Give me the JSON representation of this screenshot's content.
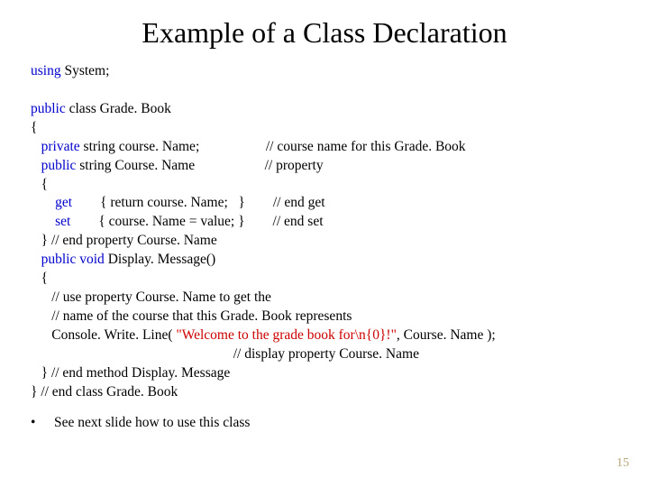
{
  "title": "Example of a Class Declaration",
  "code": {
    "l01a": "using",
    "l01b": " System;",
    "blank1": "",
    "l02a": "public",
    "l02b": " class Grade. Book",
    "l03": "{",
    "l04a": "   private",
    "l04b": " string course. Name;                   // course name for this Grade. Book",
    "l05a": "   public",
    "l05b": " string Course. Name                    // property",
    "l06": "   {",
    "l07a": "       ",
    "l07b": "get",
    "l07c": "        { return course. Name;   }        // end get",
    "l08a": "       ",
    "l08b": "set",
    "l08c": "        { course. Name = value; }        // end set",
    "l09": "   } // end property Course. Name",
    "l10a": "   public void",
    "l10b": " Display. Message()",
    "l11": "   {",
    "l12": "      // use property Course. Name to get the",
    "l13": "      // name of the course that this Grade. Book represents",
    "l14a": "      Console. Write. Line( ",
    "l14b": "\"Welcome to the grade book for\\n{0}!\"",
    "l14c": ", Course. Name );",
    "l15": "                                                          // display property Course. Name",
    "l16": "   } // end method Display. Message",
    "l17": "} // end class Grade. Book"
  },
  "bullet": {
    "dot": "•",
    "text": "See next slide how to use this class"
  },
  "page_number": "15"
}
